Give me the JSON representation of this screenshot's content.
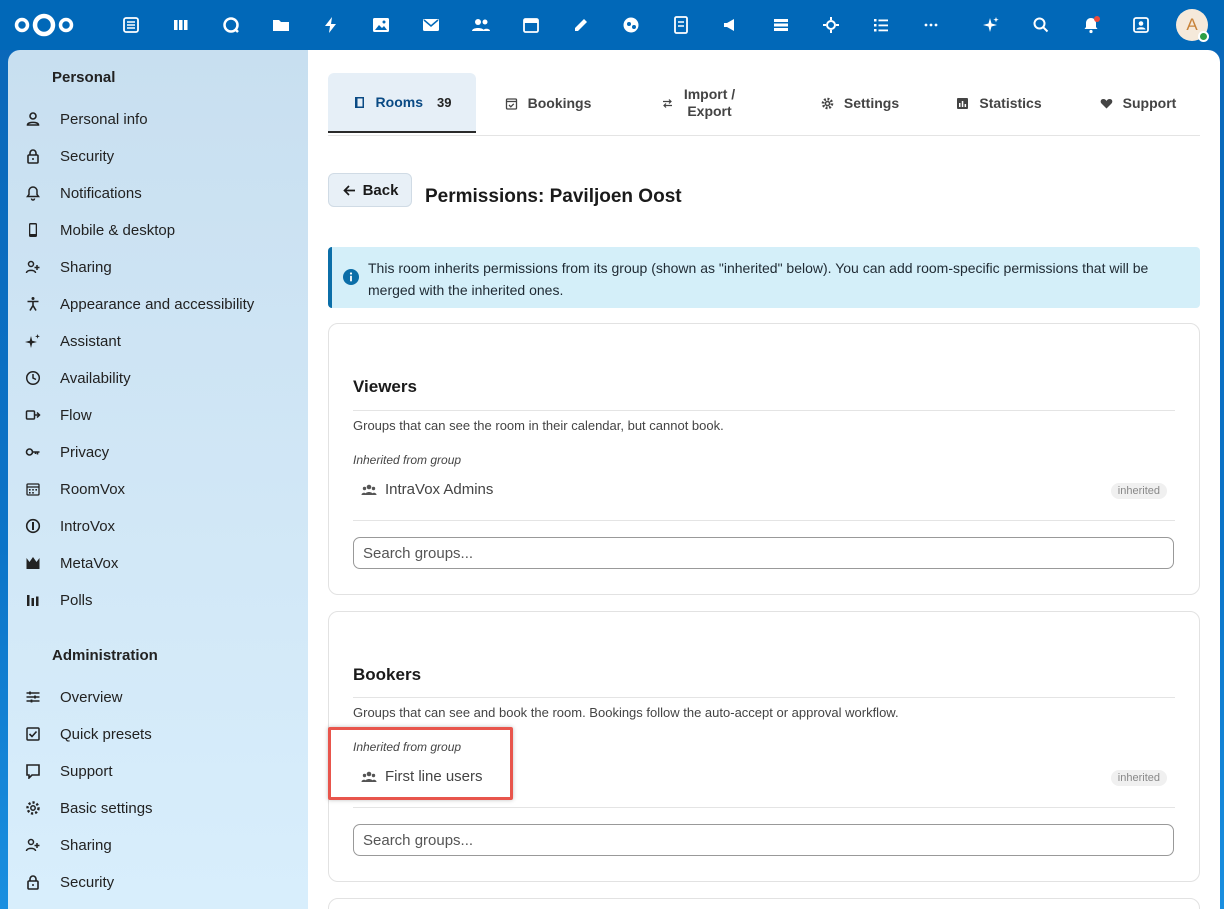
{
  "topbar": {
    "apps": [
      "dashboard-icon",
      "deck-icon",
      "talk-icon",
      "files-icon",
      "activity-icon",
      "photos-icon",
      "mail-icon",
      "contacts-icon",
      "calendar-icon",
      "notes-icon",
      "circles-icon",
      "forms-icon",
      "announcements-icon",
      "tables-icon",
      "collectives-icon",
      "tasks-icon",
      "more-apps-icon"
    ],
    "avatar_initial": "A"
  },
  "sidebar": {
    "personal_heading": "Personal",
    "personal_items": [
      {
        "label": "Personal info",
        "icon": "user-icon"
      },
      {
        "label": "Security",
        "icon": "lock-icon"
      },
      {
        "label": "Notifications",
        "icon": "bell-icon"
      },
      {
        "label": "Mobile & desktop",
        "icon": "phone-icon"
      },
      {
        "label": "Sharing",
        "icon": "share-icon"
      },
      {
        "label": "Appearance and accessibility",
        "icon": "accessibility-icon"
      },
      {
        "label": "Assistant",
        "icon": "sparkle-icon"
      },
      {
        "label": "Availability",
        "icon": "clock-icon"
      },
      {
        "label": "Flow",
        "icon": "flow-icon"
      },
      {
        "label": "Privacy",
        "icon": "key-icon"
      },
      {
        "label": "RoomVox",
        "icon": "roomvox-icon"
      },
      {
        "label": "IntroVox",
        "icon": "introvox-icon"
      },
      {
        "label": "MetaVox",
        "icon": "metavox-icon"
      },
      {
        "label": "Polls",
        "icon": "polls-icon"
      }
    ],
    "admin_heading": "Administration",
    "admin_items": [
      {
        "label": "Overview",
        "icon": "overview-icon"
      },
      {
        "label": "Quick presets",
        "icon": "presets-icon"
      },
      {
        "label": "Support",
        "icon": "support-icon"
      },
      {
        "label": "Basic settings",
        "icon": "gear-icon"
      },
      {
        "label": "Sharing",
        "icon": "share-icon"
      },
      {
        "label": "Security",
        "icon": "lock-icon"
      }
    ]
  },
  "tabs": {
    "rooms": "Rooms",
    "rooms_count": "39",
    "bookings": "Bookings",
    "import_line1": "Import /",
    "import_line2": "Export",
    "settings": "Settings",
    "statistics": "Statistics",
    "support": "Support"
  },
  "back_label": "Back",
  "page_title": "Permissions: Paviljoen Oost",
  "info_text": "This room inherits permissions from its group (shown as \"inherited\" below). You can add room-specific permissions that will be merged with the inherited ones.",
  "viewers": {
    "title": "Viewers",
    "description": "Groups that can see the room in their calendar, but cannot book.",
    "inherited_label": "Inherited from group",
    "group": "IntraVox Admins",
    "badge": "inherited",
    "search_placeholder": "Search groups..."
  },
  "bookers": {
    "title": "Bookers",
    "description": "Groups that can see and book the room. Bookings follow the auto-accept or approval workflow.",
    "inherited_label": "Inherited from group",
    "group": "First line users",
    "badge": "inherited",
    "search_placeholder": "Search groups..."
  },
  "colors": {
    "topbar": "#0168b8",
    "accent": "#0b6ea8",
    "highlight": "#e8554c",
    "info_bg": "#d4eff9"
  }
}
